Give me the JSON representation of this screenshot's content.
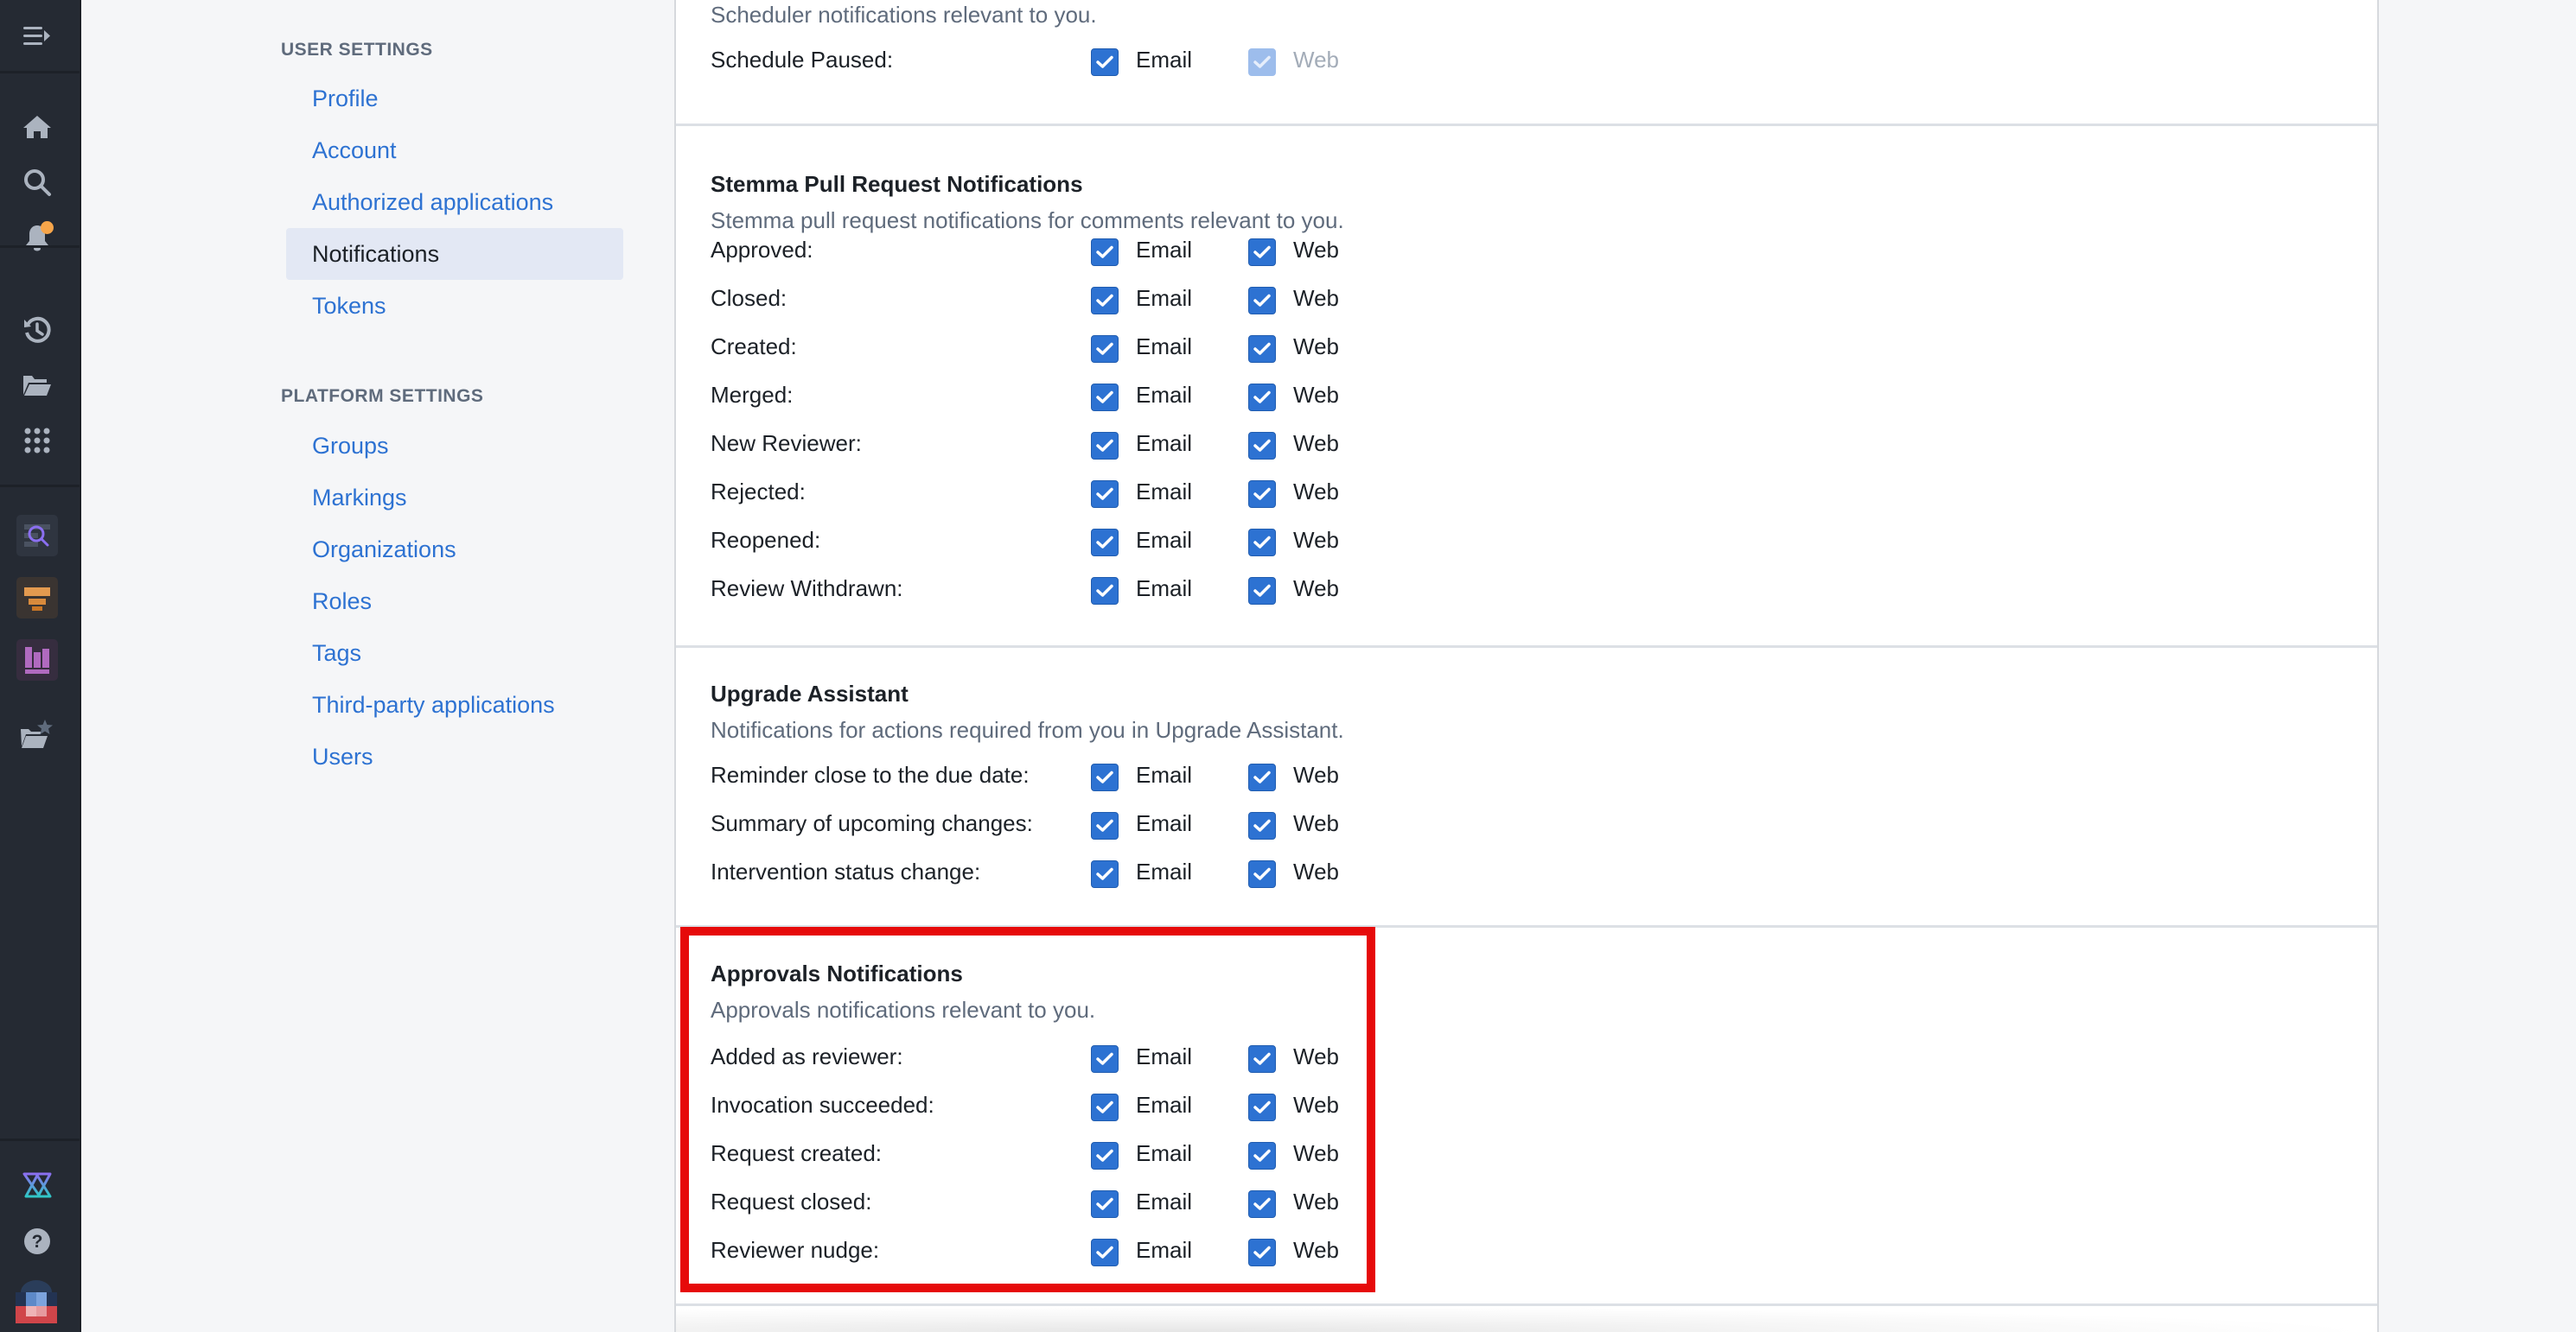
{
  "rail": {
    "icons": [
      "menu-expand-icon",
      "home-icon",
      "search-icon",
      "notifications-bell-icon",
      "history-icon",
      "folder-open-icon",
      "apps-grid-icon",
      "app-search-tile-icon",
      "app-funnel-tile-icon",
      "app-bar-chart-tile-icon",
      "favorites-folder-icon",
      "app-logo-icon",
      "help-icon",
      "user-avatar-icon"
    ],
    "notification_badge_color": "#f6a54a"
  },
  "nav": {
    "user_settings_heading": "USER SETTINGS",
    "user_settings_items": [
      {
        "label": "Profile",
        "active": false
      },
      {
        "label": "Account",
        "active": false
      },
      {
        "label": "Authorized applications",
        "active": false
      },
      {
        "label": "Notifications",
        "active": true
      },
      {
        "label": "Tokens",
        "active": false
      }
    ],
    "platform_settings_heading": "PLATFORM SETTINGS",
    "platform_settings_items": [
      {
        "label": "Groups"
      },
      {
        "label": "Markings"
      },
      {
        "label": "Organizations"
      },
      {
        "label": "Roles"
      },
      {
        "label": "Tags"
      },
      {
        "label": "Third-party applications"
      },
      {
        "label": "Users"
      }
    ]
  },
  "channels": {
    "email": "Email",
    "web": "Web"
  },
  "sections": [
    {
      "title": "",
      "description": "Scheduler notifications relevant to you.",
      "rows": [
        {
          "label": "Schedule Paused:",
          "email": true,
          "web": true,
          "web_disabled": true
        }
      ]
    },
    {
      "title": "Stemma Pull Request Notifications",
      "description": "Stemma pull request notifications for comments relevant to you.",
      "rows": [
        {
          "label": "Approved:",
          "email": true,
          "web": true
        },
        {
          "label": "Closed:",
          "email": true,
          "web": true
        },
        {
          "label": "Created:",
          "email": true,
          "web": true
        },
        {
          "label": "Merged:",
          "email": true,
          "web": true
        },
        {
          "label": "New Reviewer:",
          "email": true,
          "web": true
        },
        {
          "label": "Rejected:",
          "email": true,
          "web": true
        },
        {
          "label": "Reopened:",
          "email": true,
          "web": true
        },
        {
          "label": "Review Withdrawn:",
          "email": true,
          "web": true
        }
      ]
    },
    {
      "title": "Upgrade Assistant",
      "description": "Notifications for actions required from you in Upgrade Assistant.",
      "rows": [
        {
          "label": "Reminder close to the due date:",
          "email": true,
          "web": true
        },
        {
          "label": "Summary of upcoming changes:",
          "email": true,
          "web": true
        },
        {
          "label": "Intervention status change:",
          "email": true,
          "web": true
        }
      ]
    },
    {
      "title": "Approvals Notifications",
      "description": "Approvals notifications relevant to you.",
      "highlighted": true,
      "rows": [
        {
          "label": "Added as reviewer:",
          "email": true,
          "web": true
        },
        {
          "label": "Invocation succeeded:",
          "email": true,
          "web": true
        },
        {
          "label": "Request created:",
          "email": true,
          "web": true
        },
        {
          "label": "Request closed:",
          "email": true,
          "web": true
        },
        {
          "label": "Reviewer nudge:",
          "email": true,
          "web": true
        }
      ]
    }
  ],
  "colors": {
    "accent": "#2d72d2",
    "highlight_box": "#e60a0a",
    "rail_bg": "#252a33",
    "nav_active_bg": "#e3e8f4"
  }
}
